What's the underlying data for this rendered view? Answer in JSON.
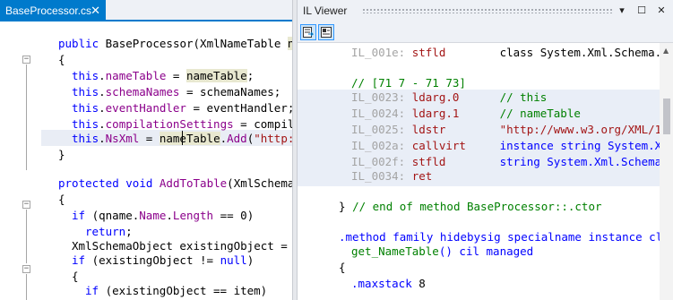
{
  "editor": {
    "tab_title": "BaseProcessor.cs",
    "tab_close": "✕",
    "lines": [
      {
        "segments": [
          {
            "t": "public",
            "c": "kw"
          },
          {
            "t": " BaseProcessor(XmlNameTable "
          },
          {
            "t": "na",
            "c": "hl"
          }
        ]
      },
      {
        "segments": [
          {
            "t": "{"
          }
        ]
      },
      {
        "segments": [
          {
            "t": "this",
            "c": "kw"
          },
          {
            "t": "."
          },
          {
            "t": "nameTable",
            "c": "mem"
          },
          {
            "t": " = "
          },
          {
            "t": "nameTable",
            "c": "hl"
          },
          {
            "t": ";"
          }
        ]
      },
      {
        "segments": [
          {
            "t": "this",
            "c": "kw"
          },
          {
            "t": "."
          },
          {
            "t": "schemaNames",
            "c": "mem"
          },
          {
            "t": " = schemaNames;"
          }
        ]
      },
      {
        "segments": [
          {
            "t": "this",
            "c": "kw"
          },
          {
            "t": "."
          },
          {
            "t": "eventHandler",
            "c": "mem"
          },
          {
            "t": " = eventHandler;"
          }
        ]
      },
      {
        "segments": [
          {
            "t": "this",
            "c": "kw"
          },
          {
            "t": "."
          },
          {
            "t": "compilationSettings",
            "c": "mem"
          },
          {
            "t": " = compila"
          }
        ]
      },
      {
        "segments": [
          {
            "t": "this",
            "c": "kw"
          },
          {
            "t": "."
          },
          {
            "t": "NsXml",
            "c": "mem"
          },
          {
            "t": " = "
          },
          {
            "t": "nameTable",
            "c": "hl"
          },
          {
            "t": "."
          },
          {
            "t": "Add",
            "c": "mem"
          },
          {
            "t": "("
          },
          {
            "t": "\"http:/",
            "c": "str"
          }
        ]
      },
      {
        "segments": [
          {
            "t": "}"
          }
        ]
      },
      {
        "segments": [
          {
            "t": ""
          }
        ]
      },
      {
        "segments": [
          {
            "t": "protected",
            "c": "kw"
          },
          {
            "t": " "
          },
          {
            "t": "void",
            "c": "kw"
          },
          {
            "t": " "
          },
          {
            "t": "AddToTable",
            "c": "mem"
          },
          {
            "t": "(XmlSchemaO"
          }
        ]
      },
      {
        "segments": [
          {
            "t": "{"
          }
        ]
      },
      {
        "segments": [
          {
            "t": "if",
            "c": "kw"
          },
          {
            "t": " (qname."
          },
          {
            "t": "Name",
            "c": "mem"
          },
          {
            "t": "."
          },
          {
            "t": "Length",
            "c": "mem"
          },
          {
            "t": " == 0)"
          }
        ]
      },
      {
        "segments": [
          {
            "t": "return",
            "c": "kw"
          },
          {
            "t": ";"
          }
        ]
      },
      {
        "segments": [
          {
            "t": "XmlSchemaObject existingObject = t"
          }
        ]
      },
      {
        "segments": [
          {
            "t": "if",
            "c": "kw"
          },
          {
            "t": " (existingObject != "
          },
          {
            "t": "null",
            "c": "kw"
          },
          {
            "t": ")"
          }
        ]
      },
      {
        "segments": [
          {
            "t": "{"
          }
        ]
      },
      {
        "segments": [
          {
            "t": "if",
            "c": "kw"
          },
          {
            "t": " (existingObject == item)"
          }
        ]
      }
    ]
  },
  "il_viewer": {
    "title": "IL Viewer",
    "toolbar_buttons": [
      "show-source-icon",
      "show-il-icon"
    ],
    "window_buttons": [
      "▾",
      "☐",
      "✕"
    ],
    "lines": [
      {
        "segments": [
          {
            "t": "IL_001e: ",
            "c": "addr"
          },
          {
            "t": "stfld",
            "c": "op"
          },
          {
            "t": "        class System.Xml.Schema."
          }
        ]
      },
      {
        "segments": [
          {
            "t": ""
          }
        ]
      },
      {
        "segments": [
          {
            "t": "// [71 7 - 71 73]",
            "c": "cmt"
          }
        ]
      },
      {
        "segments": [
          {
            "t": "IL_0023: ",
            "c": "addr"
          },
          {
            "t": "ldarg.0",
            "c": "op"
          },
          {
            "t": "      "
          },
          {
            "t": "// this",
            "c": "cmt"
          }
        ]
      },
      {
        "segments": [
          {
            "t": "IL_0024: ",
            "c": "addr"
          },
          {
            "t": "ldarg.1",
            "c": "op"
          },
          {
            "t": "      "
          },
          {
            "t": "// nameTable",
            "c": "cmt"
          }
        ]
      },
      {
        "segments": [
          {
            "t": "IL_0025: ",
            "c": "addr"
          },
          {
            "t": "ldstr",
            "c": "op"
          },
          {
            "t": "        "
          },
          {
            "t": "\"http://www.w3.org/XML/1",
            "c": "ilstr"
          }
        ]
      },
      {
        "segments": [
          {
            "t": "IL_002a: ",
            "c": "addr"
          },
          {
            "t": "callvirt",
            "c": "op"
          },
          {
            "t": "     "
          },
          {
            "t": "instance string System.X",
            "c": "ilkw"
          }
        ]
      },
      {
        "segments": [
          {
            "t": "IL_002f: ",
            "c": "addr"
          },
          {
            "t": "stfld",
            "c": "op"
          },
          {
            "t": "        "
          },
          {
            "t": "string System.Xml.Schema",
            "c": "ilkw"
          }
        ]
      },
      {
        "segments": [
          {
            "t": "IL_0034: ",
            "c": "addr"
          },
          {
            "t": "ret",
            "c": "op"
          }
        ]
      },
      {
        "segments": [
          {
            "t": ""
          }
        ]
      },
      {
        "segments": [
          {
            "t": "} "
          },
          {
            "t": "// end of method BaseProcessor::.ctor",
            "c": "cmt"
          }
        ]
      },
      {
        "segments": [
          {
            "t": ""
          }
        ]
      },
      {
        "segments": [
          {
            "t": ".method family hidebysig specialname instance cl",
            "c": "ilkw"
          }
        ]
      },
      {
        "segments": [
          {
            "t": "get_NameTable",
            "c": "cmt"
          },
          {
            "t": "() cil managed",
            "c": "ilkw"
          }
        ]
      },
      {
        "segments": [
          {
            "t": "{"
          }
        ]
      },
      {
        "segments": [
          {
            "t": ".maxstack",
            "c": "ilkw"
          },
          {
            "t": " 8"
          }
        ]
      }
    ]
  }
}
